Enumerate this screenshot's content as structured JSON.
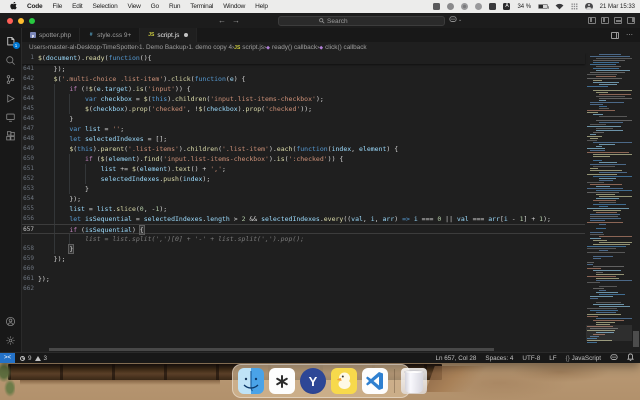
{
  "menu_bar": {
    "items": [
      "Code",
      "File",
      "Edit",
      "Selection",
      "View",
      "Go",
      "Run",
      "Terminal",
      "Window",
      "Help"
    ],
    "battery_pct": "34 %",
    "clock": "21 Mar 15:33"
  },
  "title_bar": {
    "search_placeholder": "Search",
    "back": "←",
    "forward": "→"
  },
  "tabs": [
    {
      "label": "spotter.php",
      "icon": "php",
      "active": false,
      "modified": false,
      "badge": ""
    },
    {
      "label": "style.css",
      "icon": "css",
      "active": false,
      "modified": false,
      "badge": "9+"
    },
    {
      "label": "script.js",
      "icon": "js",
      "active": true,
      "modified": true,
      "badge": ""
    }
  ],
  "breadcrumbs": [
    {
      "label": "Users",
      "icon": ""
    },
    {
      "label": "master-al",
      "icon": ""
    },
    {
      "label": "Desktop",
      "icon": ""
    },
    {
      "label": "TimeSpotter",
      "icon": ""
    },
    {
      "label": "1. Demo Backup",
      "icon": ""
    },
    {
      "label": "1. demo copy 4",
      "icon": ""
    },
    {
      "label": "script.js",
      "icon": "js"
    },
    {
      "label": "ready() callback",
      "icon": "sym"
    },
    {
      "label": "click() callback",
      "icon": "sym"
    }
  ],
  "editor": {
    "sticky": {
      "n": "1",
      "i": 0,
      "t": [
        [
          "f",
          "$"
        ],
        [
          "p",
          "("
        ],
        [
          "v",
          "document"
        ],
        [
          "p",
          ")."
        ],
        [
          "f",
          "ready"
        ],
        [
          "p",
          "("
        ],
        [
          "k",
          "function"
        ],
        [
          "p",
          "(){"
        ]
      ]
    },
    "lines": [
      {
        "n": "641",
        "i": 4,
        "t": [
          [
            "p",
            "});"
          ]
        ]
      },
      {
        "n": "642",
        "i": 4,
        "t": [
          [
            "f",
            "$"
          ],
          [
            "p",
            "("
          ],
          [
            "s",
            "'.multi-choice .list-item'"
          ],
          [
            "p",
            ")."
          ],
          [
            "f",
            "click"
          ],
          [
            "p",
            "("
          ],
          [
            "k",
            "function"
          ],
          [
            "p",
            "("
          ],
          [
            "v",
            "e"
          ],
          [
            "p",
            ") {"
          ]
        ]
      },
      {
        "n": "643",
        "i": 8,
        "t": [
          [
            "c",
            "if"
          ],
          [
            "p",
            " (!"
          ],
          [
            "f",
            "$"
          ],
          [
            "p",
            "("
          ],
          [
            "v",
            "e"
          ],
          [
            "p",
            "."
          ],
          [
            "v",
            "target"
          ],
          [
            "p",
            ")."
          ],
          [
            "f",
            "is"
          ],
          [
            "p",
            "("
          ],
          [
            "s",
            "'input'"
          ],
          [
            "p",
            ")) {"
          ]
        ]
      },
      {
        "n": "644",
        "i": 12,
        "t": [
          [
            "k",
            "var"
          ],
          [
            "p",
            " "
          ],
          [
            "v",
            "checkbox"
          ],
          [
            "p",
            " = "
          ],
          [
            "f",
            "$"
          ],
          [
            "p",
            "("
          ],
          [
            "k",
            "this"
          ],
          [
            "p",
            ")."
          ],
          [
            "f",
            "children"
          ],
          [
            "p",
            "("
          ],
          [
            "s",
            "'input.list-items-checkbox'"
          ],
          [
            "p",
            ");"
          ]
        ]
      },
      {
        "n": "645",
        "i": 12,
        "t": [
          [
            "f",
            "$"
          ],
          [
            "p",
            "("
          ],
          [
            "v",
            "checkbox"
          ],
          [
            "p",
            ")."
          ],
          [
            "f",
            "prop"
          ],
          [
            "p",
            "("
          ],
          [
            "s",
            "'checked'"
          ],
          [
            "p",
            ", !"
          ],
          [
            "f",
            "$"
          ],
          [
            "p",
            "("
          ],
          [
            "v",
            "checkbox"
          ],
          [
            "p",
            ")."
          ],
          [
            "f",
            "prop"
          ],
          [
            "p",
            "("
          ],
          [
            "s",
            "'checked'"
          ],
          [
            "p",
            "));"
          ]
        ]
      },
      {
        "n": "646",
        "i": 8,
        "t": [
          [
            "p",
            "}"
          ]
        ]
      },
      {
        "n": "647",
        "i": 8,
        "t": [
          [
            "k",
            "var"
          ],
          [
            "p",
            " "
          ],
          [
            "v",
            "list"
          ],
          [
            "p",
            " = "
          ],
          [
            "s",
            "''"
          ],
          [
            "p",
            ";"
          ]
        ]
      },
      {
        "n": "648",
        "i": 8,
        "t": [
          [
            "k",
            "let"
          ],
          [
            "p",
            " "
          ],
          [
            "v",
            "selectedIndexes"
          ],
          [
            "p",
            " = [];"
          ]
        ]
      },
      {
        "n": "649",
        "i": 8,
        "t": [
          [
            "f",
            "$"
          ],
          [
            "p",
            "("
          ],
          [
            "k",
            "this"
          ],
          [
            "p",
            ")."
          ],
          [
            "f",
            "parent"
          ],
          [
            "p",
            "("
          ],
          [
            "s",
            "'.list-items'"
          ],
          [
            "p",
            ")."
          ],
          [
            "f",
            "children"
          ],
          [
            "p",
            "("
          ],
          [
            "s",
            "'.list-item'"
          ],
          [
            "p",
            ")."
          ],
          [
            "f",
            "each"
          ],
          [
            "p",
            "("
          ],
          [
            "k",
            "function"
          ],
          [
            "p",
            "("
          ],
          [
            "v",
            "index"
          ],
          [
            "p",
            ", "
          ],
          [
            "v",
            "element"
          ],
          [
            "p",
            ") {"
          ]
        ]
      },
      {
        "n": "650",
        "i": 12,
        "t": [
          [
            "c",
            "if"
          ],
          [
            "p",
            " ("
          ],
          [
            "f",
            "$"
          ],
          [
            "p",
            "("
          ],
          [
            "v",
            "element"
          ],
          [
            "p",
            ")."
          ],
          [
            "f",
            "find"
          ],
          [
            "p",
            "("
          ],
          [
            "s",
            "'input.list-items-checkbox'"
          ],
          [
            "p",
            ")."
          ],
          [
            "f",
            "is"
          ],
          [
            "p",
            "("
          ],
          [
            "s",
            "':checked'"
          ],
          [
            "p",
            ")) {"
          ]
        ]
      },
      {
        "n": "651",
        "i": 16,
        "t": [
          [
            "v",
            "list"
          ],
          [
            "p",
            " += "
          ],
          [
            "f",
            "$"
          ],
          [
            "p",
            "("
          ],
          [
            "v",
            "element"
          ],
          [
            "p",
            ")."
          ],
          [
            "f",
            "text"
          ],
          [
            "p",
            "() + "
          ],
          [
            "s",
            "','"
          ],
          [
            "p",
            ";"
          ]
        ]
      },
      {
        "n": "652",
        "i": 16,
        "t": [
          [
            "v",
            "selectedIndexes"
          ],
          [
            "p",
            "."
          ],
          [
            "f",
            "push"
          ],
          [
            "p",
            "("
          ],
          [
            "v",
            "index"
          ],
          [
            "p",
            ");"
          ]
        ]
      },
      {
        "n": "653",
        "i": 12,
        "t": [
          [
            "p",
            "}"
          ]
        ]
      },
      {
        "n": "654",
        "i": 8,
        "t": [
          [
            "p",
            "});"
          ]
        ]
      },
      {
        "n": "655",
        "i": 8,
        "t": [
          [
            "v",
            "list"
          ],
          [
            "p",
            " = "
          ],
          [
            "v",
            "list"
          ],
          [
            "p",
            "."
          ],
          [
            "f",
            "slice"
          ],
          [
            "p",
            "("
          ],
          [
            "n2",
            "0"
          ],
          [
            "p",
            ", -"
          ],
          [
            "n2",
            "1"
          ],
          [
            "p",
            ");"
          ]
        ]
      },
      {
        "n": "656",
        "i": 8,
        "t": [
          [
            "k",
            "let"
          ],
          [
            "p",
            " "
          ],
          [
            "v",
            "isSequential"
          ],
          [
            "p",
            " = "
          ],
          [
            "v",
            "selectedIndexes"
          ],
          [
            "p",
            "."
          ],
          [
            "v",
            "length"
          ],
          [
            "p",
            " > "
          ],
          [
            "n2",
            "2"
          ],
          [
            "p",
            " && "
          ],
          [
            "v",
            "selectedIndexes"
          ],
          [
            "p",
            "."
          ],
          [
            "f",
            "every"
          ],
          [
            "p",
            "(("
          ],
          [
            "v",
            "val"
          ],
          [
            "p",
            ", "
          ],
          [
            "v",
            "i"
          ],
          [
            "p",
            ", "
          ],
          [
            "v",
            "arr"
          ],
          [
            "p",
            ") "
          ],
          [
            "k",
            "=>"
          ],
          [
            "p",
            " "
          ],
          [
            "v",
            "i"
          ],
          [
            "p",
            " === "
          ],
          [
            "n2",
            "0"
          ],
          [
            "p",
            " || "
          ],
          [
            "v",
            "val"
          ],
          [
            "p",
            " === "
          ],
          [
            "v",
            "arr"
          ],
          [
            "p",
            "["
          ],
          [
            "v",
            "i"
          ],
          [
            "p",
            " - "
          ],
          [
            "n2",
            "1"
          ],
          [
            "p",
            "] + "
          ],
          [
            "n2",
            "1"
          ],
          [
            "p",
            ");"
          ]
        ]
      },
      {
        "n": "657",
        "i": 8,
        "current": true,
        "cursor": true,
        "t": [
          [
            "c",
            "if"
          ],
          [
            "p",
            " ("
          ],
          [
            "v",
            "isSequential"
          ],
          [
            "p",
            ") "
          ],
          [
            "b",
            "{"
          ]
        ]
      },
      {
        "n": "",
        "i": 12,
        "ghost": true,
        "t": [
          [
            "g",
            "list = list.split(',')[0] + '-' + list.split(',').pop();"
          ]
        ]
      },
      {
        "n": "658",
        "i": 8,
        "t": [
          [
            "b",
            "}"
          ]
        ]
      },
      {
        "n": "659",
        "i": 4,
        "t": [
          [
            "p",
            "});"
          ]
        ]
      },
      {
        "n": "660",
        "i": 0,
        "t": []
      },
      {
        "n": "661",
        "i": 0,
        "t": [
          [
            "p",
            "});"
          ]
        ]
      },
      {
        "n": "662",
        "i": 0,
        "t": []
      }
    ]
  },
  "status_bar": {
    "errors": "9",
    "warnings": "3",
    "cursor_pos": "Ln 657, Col 28",
    "spaces": "Spaces: 4",
    "encoding": "UTF-8",
    "eol": "LF",
    "language": "JavaScript"
  },
  "dock": [
    "finder",
    "chatgpt",
    "yandex",
    "cyberduck",
    "vscode",
    "trash"
  ]
}
